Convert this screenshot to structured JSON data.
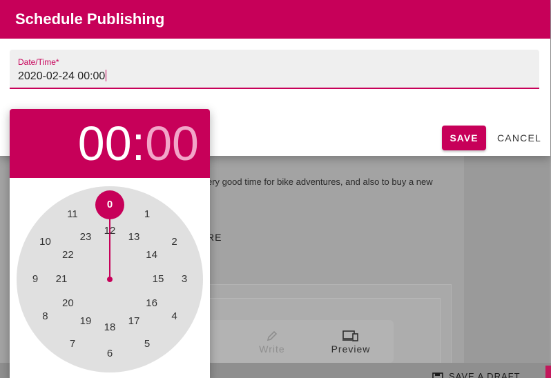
{
  "dialog": {
    "title": "Schedule Publishing",
    "field_label": "Date/Time*",
    "field_value": "2020-02-24 00:00",
    "save_label": "SAVE",
    "cancel_label": "CANCEL"
  },
  "picker": {
    "hour": "00",
    "separator": ":",
    "minute": "00",
    "selected_hour": 0,
    "outer_hours": [
      "0",
      "1",
      "2",
      "3",
      "4",
      "5",
      "6",
      "7",
      "8",
      "9",
      "10",
      "11"
    ],
    "inner_hours": [
      "12",
      "13",
      "14",
      "15",
      "16",
      "17",
      "18",
      "19",
      "20",
      "21",
      "22",
      "23"
    ]
  },
  "background": {
    "text_line": "ery good time for bike adventures, and also to buy a new",
    "fragment": "RE",
    "tab_write": "Write",
    "tab_preview": "Preview",
    "draft_label": "SAVE A DRAFT"
  },
  "colors": {
    "accent": "#c70059",
    "accent_light": "#f2a5c8",
    "clock_face": "#e0e0e0"
  }
}
